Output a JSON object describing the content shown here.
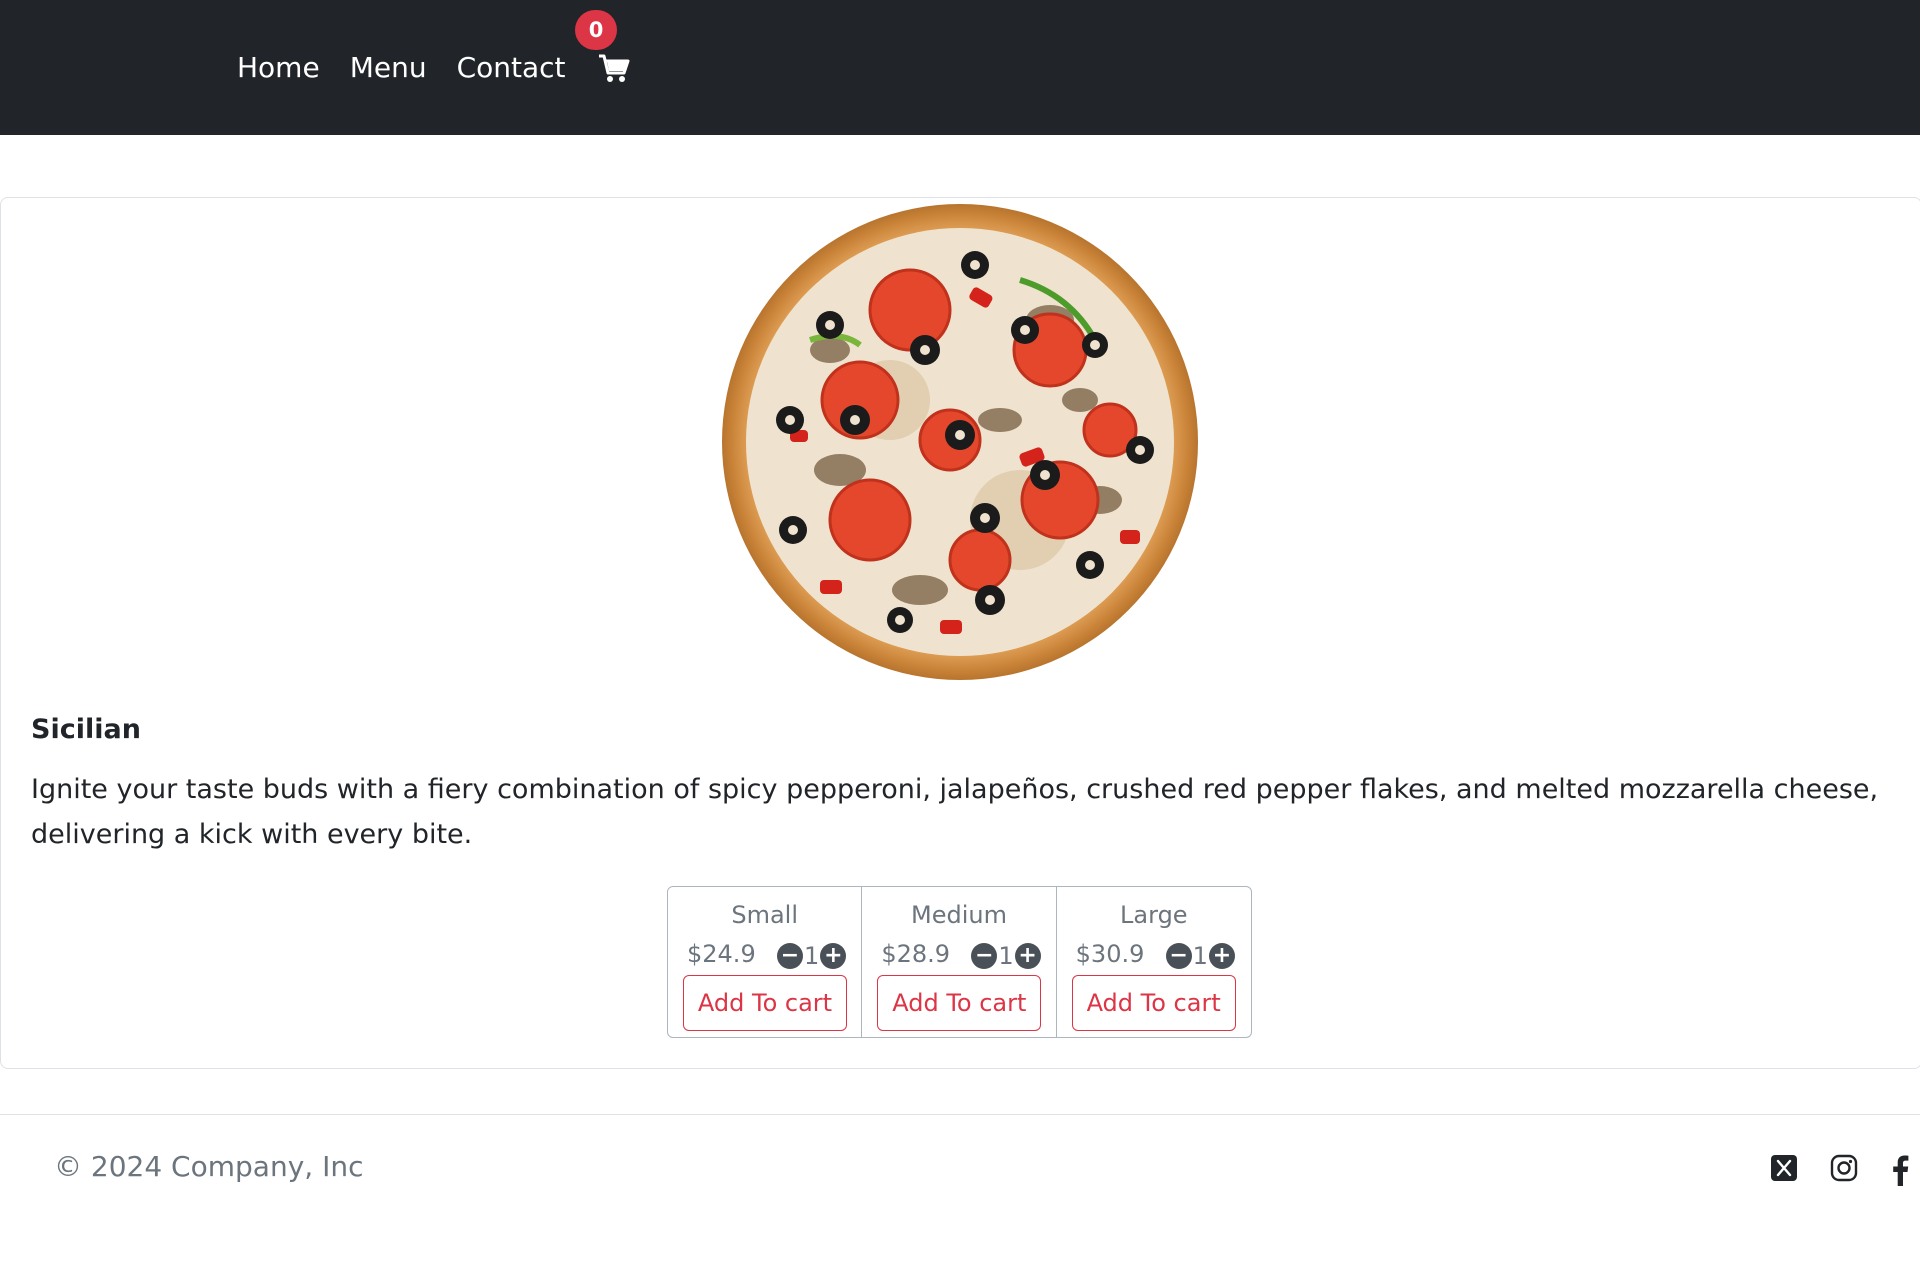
{
  "nav": {
    "links": [
      "Home",
      "Menu",
      "Contact"
    ],
    "cart_count": "0"
  },
  "product": {
    "title": "Sicilian",
    "description": "Ignite your taste buds with a fiery combination of spicy pepperoni, jalapeños, crushed red pepper flakes, and melted mozzarella cheese, delivering a kick with every bite.",
    "sizes": [
      {
        "name": "Small",
        "price": "$24.9",
        "qty": "1",
        "button": "Add To cart"
      },
      {
        "name": "Medium",
        "price": "$28.9",
        "qty": "1",
        "button": "Add To cart"
      },
      {
        "name": "Large",
        "price": "$30.9",
        "qty": "1",
        "button": "Add To cart"
      }
    ]
  },
  "footer": {
    "copyright": "© 2024 Company, Inc",
    "social_icons": [
      "x-twitter-icon",
      "instagram-icon",
      "facebook-icon"
    ]
  },
  "colors": {
    "navbar": "#212529",
    "accent": "#dc3545",
    "muted": "#6c757d"
  }
}
